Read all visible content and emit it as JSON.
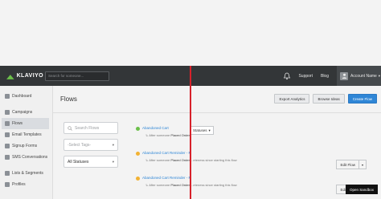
{
  "topbar": {
    "logo_text": "KLAVIYO",
    "search_placeholder": "Search for someone...",
    "links": [
      "Support",
      "Blog"
    ],
    "account_name": "Account Name",
    "account_caret": "▾"
  },
  "sidebar": {
    "items": [
      {
        "label": "Dashboard",
        "icon": "dashboard-icon"
      },
      {
        "label": "Campaigns",
        "icon": "campaigns-icon"
      },
      {
        "label": "Flows",
        "icon": "flows-icon",
        "active": true
      },
      {
        "label": "Email Templates",
        "icon": "templates-icon"
      },
      {
        "label": "Signup Forms",
        "icon": "forms-icon"
      },
      {
        "label": "SMS Conversations",
        "icon": "sms-icon"
      },
      {
        "label": "Lists & Segments",
        "icon": "lists-icon"
      },
      {
        "label": "Profiles",
        "icon": "profiles-icon"
      }
    ]
  },
  "page": {
    "title": "Flows",
    "buttons": {
      "export": "Export Analytics",
      "browse": "Browse Ideas",
      "create": "Create Flow"
    }
  },
  "filters": {
    "search_placeholder": "Search Flows",
    "tags_placeholder": "-Select Tags-",
    "status_value": "All Statuses",
    "caret": "▾"
  },
  "flows": [
    {
      "name": "Abandoned Cart",
      "dot_color": "#6cc04a",
      "sub_prefix": "After someone",
      "sub_bold": "Placed Order",
      "sub_suffix": "",
      "status": "Statuses",
      "status_caret": "▾"
    },
    {
      "name": "Abandoned Cart Reminder - M",
      "dot_color": "#f2b233",
      "sub_prefix": "After someone",
      "sub_bold": "Placed Order",
      "sub_suffix": "...eteness since starting this flow",
      "edit": "Edit Flow",
      "edit_caret": "▾"
    },
    {
      "name": "Abandoned Cart Reminder - M",
      "dot_color": "#f2b233",
      "sub_prefix": "After someone",
      "sub_bold": "Placed Order",
      "sub_suffix": "...eteness since starting this flow",
      "edit": "Edit Flow",
      "edit_caret": "▾"
    }
  ],
  "sandbox_label": "Open Sandbox",
  "colors": {
    "accent": "#2f86d6",
    "topbar": "#333638",
    "marker": "#d7212a"
  }
}
